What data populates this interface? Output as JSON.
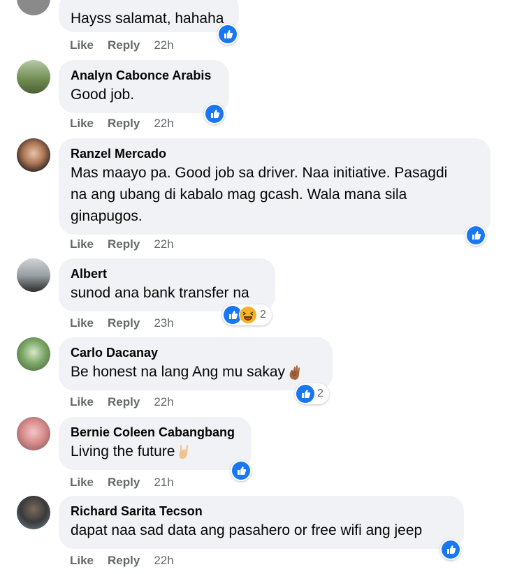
{
  "comments": [
    {
      "author": "",
      "text": "Hayss salamat, hahaha",
      "like": "Like",
      "reply": "Reply",
      "time": "22h",
      "reactions": {
        "count": ""
      }
    },
    {
      "author": "Analyn Cabonce Arabis",
      "text": "Good job.",
      "like": "Like",
      "reply": "Reply",
      "time": "22h",
      "reactions": {
        "count": ""
      }
    },
    {
      "author": "Ranzel Mercado",
      "text_lines": [
        "Mas maayo pa. Good job sa driver. Naa initiative. Pasagdi",
        "na ang ubang di kabalo mag gcash. Wala mana sila",
        "ginapugos."
      ],
      "like": "Like",
      "reply": "Reply",
      "time": "22h",
      "reactions": {
        "count": ""
      }
    },
    {
      "author": "Albert",
      "text": "sunod ana bank transfer na",
      "like": "Like",
      "reply": "Reply",
      "time": "23h",
      "reactions": {
        "count": "2"
      }
    },
    {
      "author": "Carlo Dacanay",
      "text": "Be honest na lang Ang mu sakay",
      "like": "Like",
      "reply": "Reply",
      "time": "22h",
      "reactions": {
        "count": "2"
      }
    },
    {
      "author": "Bernie Coleen Cabangbang",
      "text": "Living the future",
      "like": "Like",
      "reply": "Reply",
      "time": "21h",
      "reactions": {
        "count": ""
      }
    },
    {
      "author": "Richard Sarita Tecson",
      "text": "dapat naa sad data ang pasahero or free wifi ang jeep",
      "like": "Like",
      "reply": "Reply",
      "time": "22h",
      "reactions": {
        "count": ""
      }
    }
  ],
  "icons": {
    "like": "like-reaction-icon",
    "haha": "haha-reaction-icon",
    "ok_hand": "ok-hand-emoji-icon",
    "rock": "rock-on-emoji-icon"
  },
  "colors": {
    "like_blue": "#1877f2",
    "bubble": "#f0f2f5",
    "meta_gray": "#65676b"
  }
}
